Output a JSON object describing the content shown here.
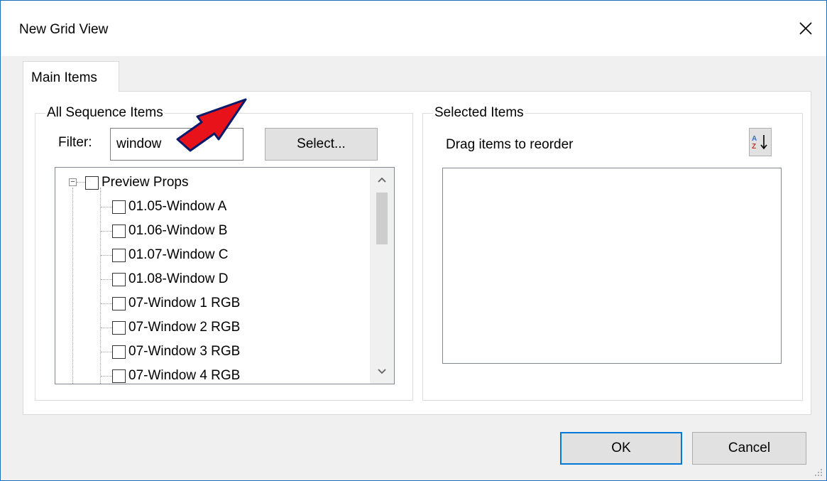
{
  "window": {
    "title": "New Grid View"
  },
  "tabs": [
    {
      "label": "Main Items"
    }
  ],
  "all_items": {
    "legend": "All Sequence Items",
    "filter_label": "Filter:",
    "filter_value": "window",
    "select_button": "Select...",
    "tree": {
      "root": "Preview Props",
      "children": [
        "01.05-Window A",
        "01.06-Window B",
        "01.07-Window C",
        "01.08-Window D",
        "07-Window 1 RGB",
        "07-Window 2 RGB",
        "07-Window 3 RGB",
        "07-Window 4 RGB"
      ]
    }
  },
  "selected_items": {
    "legend": "Selected Items",
    "hint": "Drag items to reorder",
    "sort_icon": "sort-az-icon"
  },
  "footer": {
    "ok": "OK",
    "cancel": "Cancel"
  },
  "colors": {
    "accent": "#0078d7",
    "annotation_arrow": "#e8121b"
  }
}
